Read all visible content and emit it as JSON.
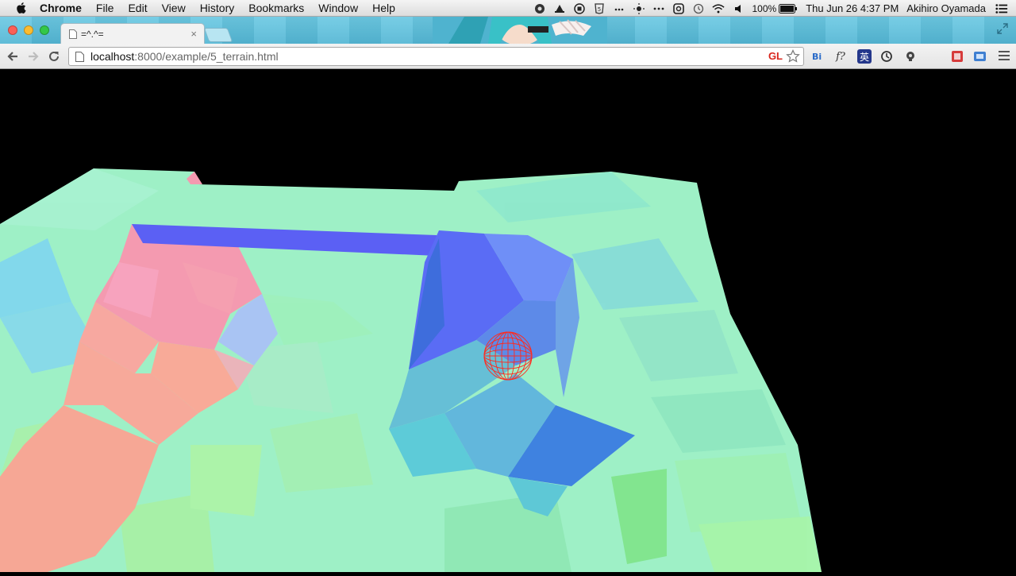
{
  "menubar": {
    "app_name": "Chrome",
    "items": [
      "File",
      "Edit",
      "View",
      "History",
      "Bookmarks",
      "Window",
      "Help"
    ],
    "battery": "100%",
    "clock": "Thu Jun 26  4:37 PM",
    "user": "Akihiro Oyamada"
  },
  "tab": {
    "title": "=^.^=",
    "close_glyph": "×"
  },
  "omnibox": {
    "host": "localhost",
    "path": ":8000/example/5_terrain.html",
    "badge": "GL"
  },
  "extensions": [
    "f?",
    "英"
  ],
  "colors": {
    "tabstrip": "#5bbfdc",
    "terrain_mint": "#9ef0c6",
    "terrain_pink": "#f49ab0",
    "terrain_blue": "#5a6cf5",
    "sphere_wireframe": "#ff2a1f"
  }
}
